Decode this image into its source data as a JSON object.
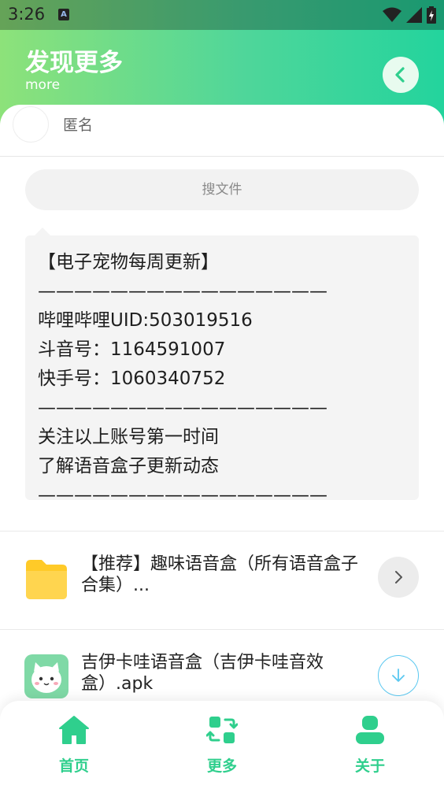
{
  "status_bar": {
    "time": "3:26",
    "notification_letter": "A"
  },
  "header": {
    "title": "发现更多",
    "subtitle": "more"
  },
  "user": {
    "name": "匿名"
  },
  "search": {
    "placeholder": "搜文件"
  },
  "notice": {
    "lines": [
      "【电子宠物每周更新】",
      "————————————————",
      "哔哩哔哩UID:503019516",
      "斗音号：1164591007",
      "快手号：1060340752",
      "————————————————",
      "关注以上账号第一时间",
      "了解语音盒子更新动态",
      "————————————————"
    ]
  },
  "files": [
    {
      "name": "【推荐】趣味语音盒（所有语音盒子合集）...",
      "icon": "folder-icon",
      "action": "chevron-right-icon"
    },
    {
      "name": "吉伊卡哇语音盒（吉伊卡哇音效盒）.apk",
      "icon": "app-icon",
      "action": "download-icon"
    }
  ],
  "bottom_nav": [
    {
      "label": "首页",
      "icon": "home-icon"
    },
    {
      "label": "更多",
      "icon": "swap-icon"
    },
    {
      "label": "关于",
      "icon": "user-icon"
    }
  ],
  "colors": {
    "accent": "#2fcf8d",
    "header_gradient_start": "#8de27a",
    "header_gradient_end": "#23d49d",
    "folder": "#ffd54f",
    "download_ring": "#5bc8f0"
  }
}
